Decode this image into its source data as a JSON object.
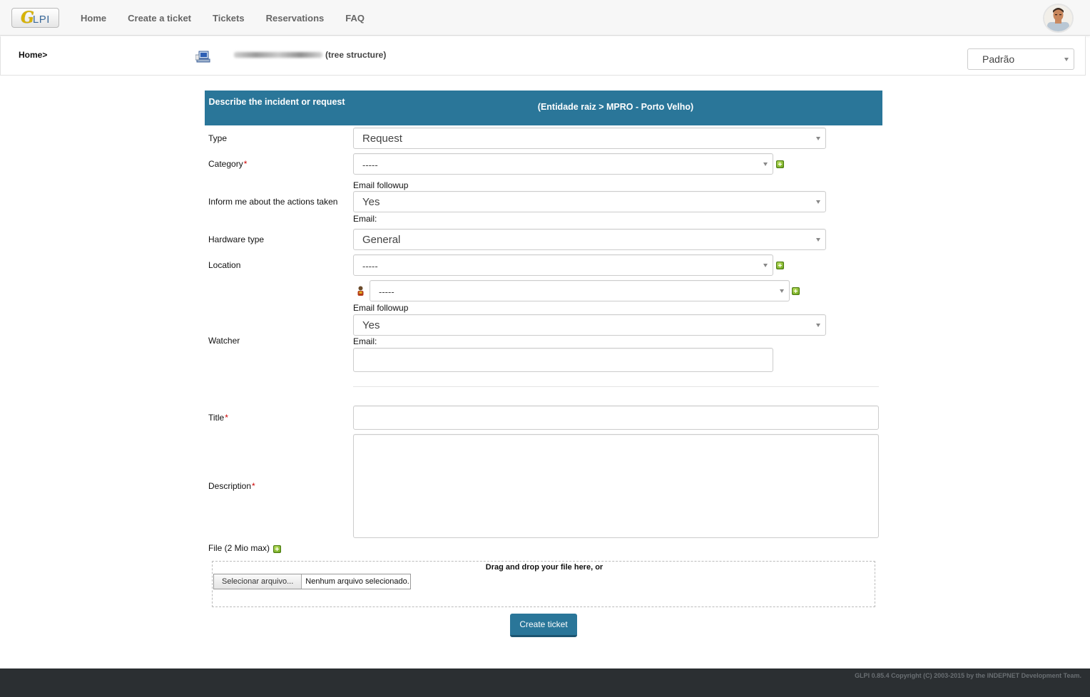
{
  "nav": {
    "logo_mark": "G",
    "logo_text": "LPI",
    "items": [
      {
        "label": "Home"
      },
      {
        "label": "Create a ticket"
      },
      {
        "label": "Tickets"
      },
      {
        "label": "Reservations"
      },
      {
        "label": "FAQ"
      }
    ]
  },
  "breadcrumb": {
    "home": "Home>",
    "tree_label": "(tree structure)",
    "profile": "Padrão"
  },
  "form": {
    "header_left": "Describe the incident or request",
    "header_right": "(Entidade raiz > MPRO - Porto Velho)",
    "type": {
      "label": "Type",
      "value": "Request"
    },
    "category": {
      "label": "Category",
      "value": "-----",
      "required": "*"
    },
    "inform": {
      "label": "Inform me about the actions taken",
      "followup_label": "Email followup",
      "followup_value": "Yes",
      "email_label": "Email:"
    },
    "hardware_type": {
      "label": "Hardware type",
      "value": "General"
    },
    "location": {
      "label": "Location",
      "value": "-----"
    },
    "watcher": {
      "label": "Watcher",
      "user_value": "-----",
      "followup_label": "Email followup",
      "followup_value": "Yes",
      "email_label": "Email:",
      "email_value": ""
    },
    "title": {
      "label": "Title",
      "required": "*",
      "value": ""
    },
    "description": {
      "label": "Description",
      "required": "*",
      "value": ""
    },
    "file": {
      "label": "File (2 Mio max)",
      "drop_text": "Drag and drop your file here, or",
      "button_label": "Selecionar arquivo...",
      "status": "Nenhum arquivo selecionado."
    },
    "submit_label": "Create ticket"
  },
  "footer": {
    "copyright": "GLPI 0.85.4 Copyright (C) 2003-2015 by the INDEPNET Development Team."
  },
  "colors": {
    "header_bg": "#2a7699",
    "footer_bg": "#2b2f32",
    "required": "#cc0000"
  },
  "icons": {
    "tree": "tree-structure-icon",
    "add": "add-plus-icon",
    "watcher": "user-icon",
    "avatar": "avatar"
  }
}
